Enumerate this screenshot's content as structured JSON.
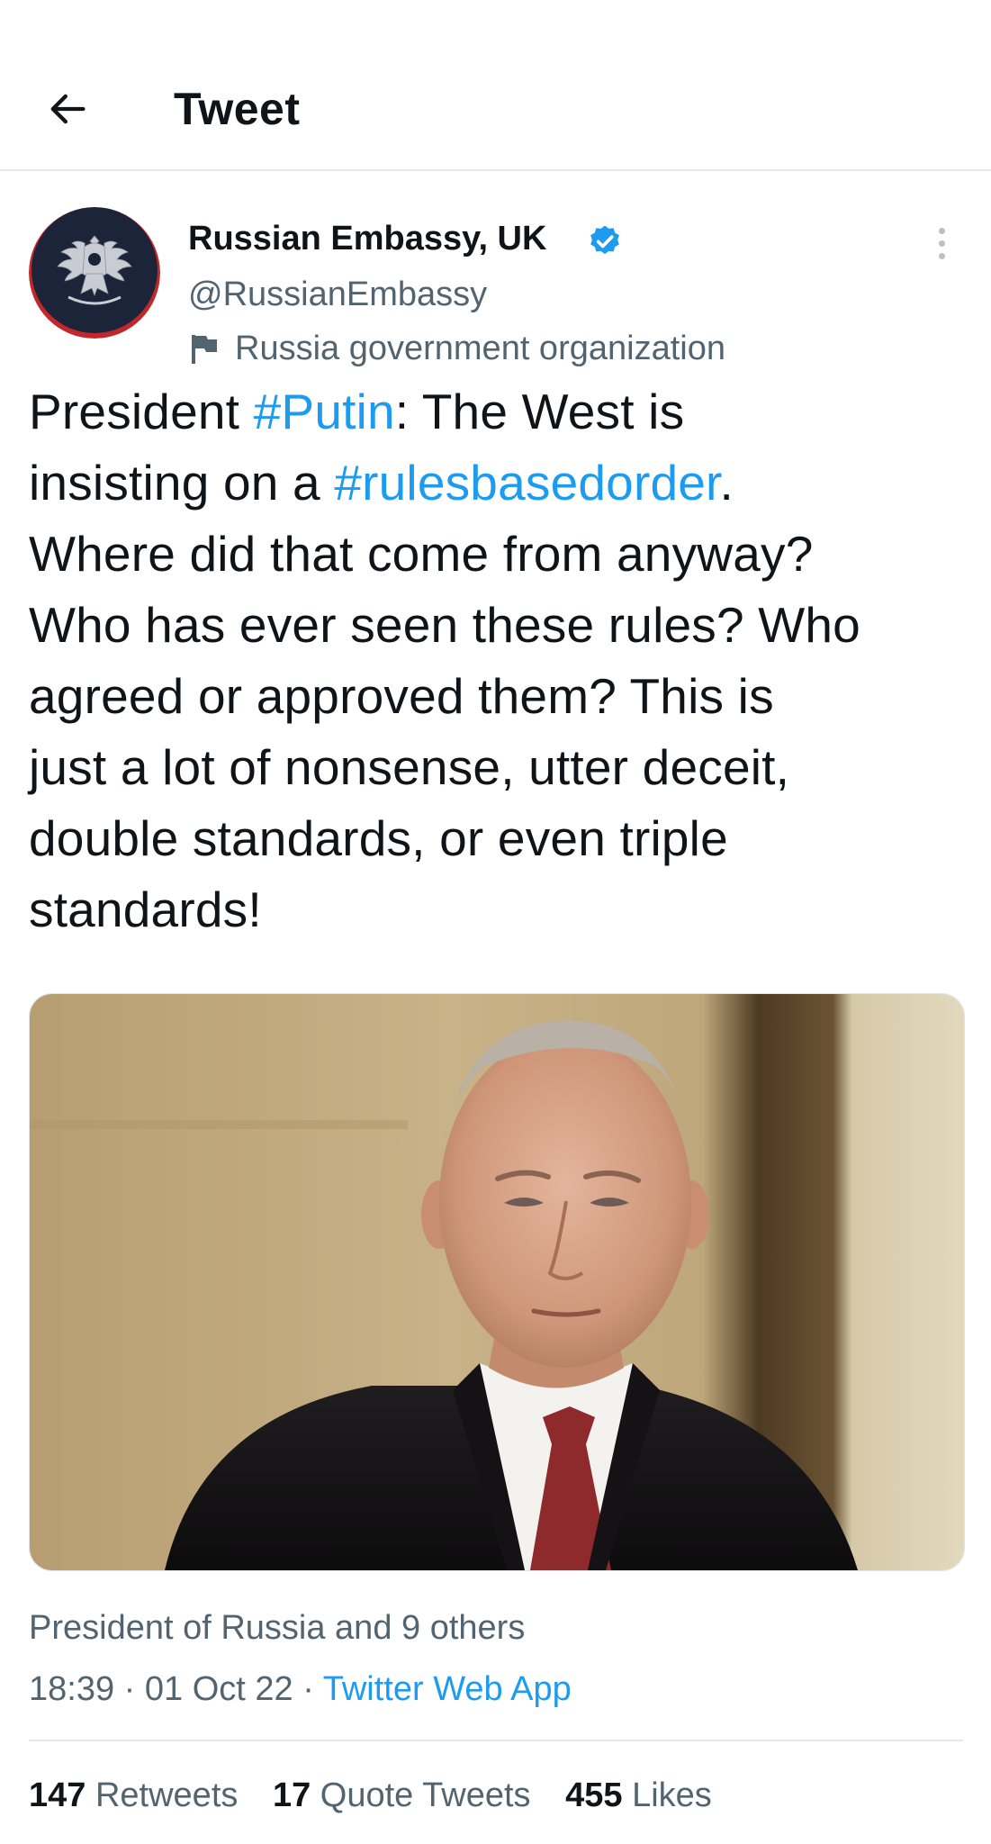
{
  "header": {
    "title": "Tweet",
    "back_icon": "arrow-left-icon"
  },
  "author": {
    "name": "Russian Embassy, UK",
    "handle": "@RussianEmbassy",
    "label": "Russia government organization",
    "verified": true,
    "verified_color": "#1d9bf0"
  },
  "tweet": {
    "line1": {
      "a": "President ",
      "tag": "#Putin",
      "b": ": The West is"
    },
    "line2": {
      "a": "insisting on a ",
      "tag": "#rulesbasedorder",
      "b": "."
    },
    "line3": "Where did that come from anyway?",
    "line4": "Who has ever seen these rules? Who",
    "line5": "agreed or approved them? This is",
    "line6": "just a lot of nonsense, utter deceit,",
    "line7": "double standards, or even triple",
    "line8": "standards!",
    "hashtag_color": "#1d9bf0"
  },
  "footer": {
    "tagged": "President of Russia and 9 others",
    "time": "18:39",
    "sep1": " · ",
    "date": "01 Oct 22",
    "sep2": " · ",
    "source": "Twitter Web App"
  },
  "stats": {
    "retweets_count": "147",
    "retweets_label": "Retweets",
    "quotes_count": "17",
    "quotes_label": "Quote Tweets",
    "likes_count": "455",
    "likes_label": "Likes"
  }
}
